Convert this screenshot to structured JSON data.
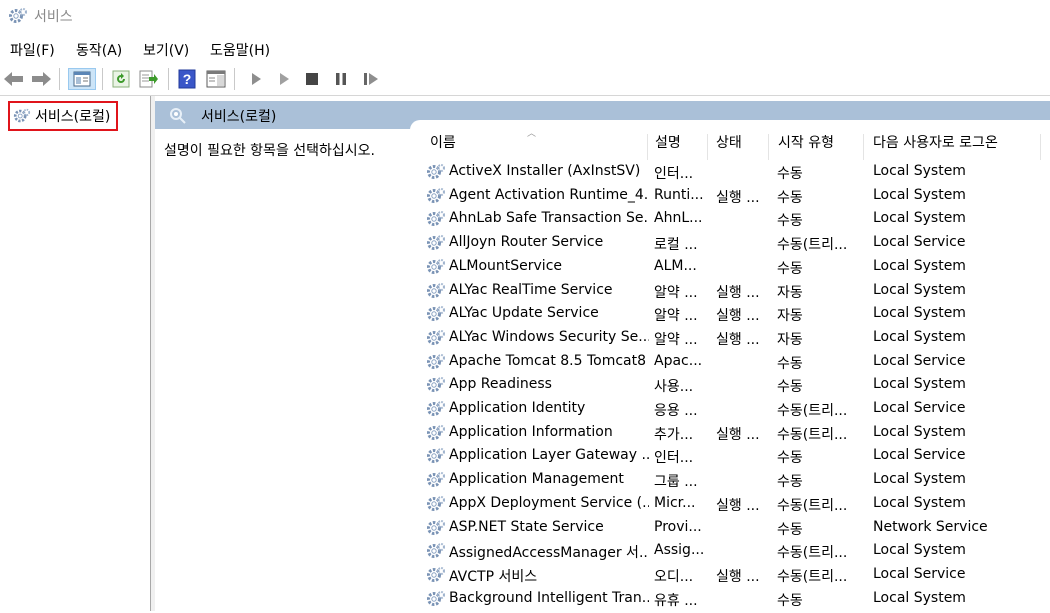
{
  "window": {
    "title": "서비스",
    "icon": "services-gear-icon"
  },
  "menu": [
    "파일(F)",
    "동작(A)",
    "보기(V)",
    "도움말(H)"
  ],
  "toolbar": {
    "buttons": [
      "back-arrow-icon",
      "forward-arrow-icon",
      "show-hide-console-tree-icon",
      "refresh-icon",
      "export-list-icon",
      "help-icon",
      "properties-pane-icon",
      "start-service-icon",
      "start-service-alt-icon",
      "stop-service-icon",
      "pause-service-icon",
      "restart-service-icon"
    ]
  },
  "tree": {
    "selected_label": "서비스(로컬)",
    "highlight_color": "#e0141b"
  },
  "right_pane": {
    "header_title": "서비스(로컬)",
    "header_color": "#aac0d8",
    "description_hint": "설명이 필요한 항목을 선택하십시오."
  },
  "columns": {
    "name": "이름",
    "description": "설명",
    "status": "상태",
    "startup": "시작 유형",
    "logon": "다음 사용자로 로그온"
  },
  "services": [
    {
      "name": "ActiveX Installer (AxInstSV)",
      "desc": "인터...",
      "status": "",
      "startup": "수동",
      "logon": "Local System"
    },
    {
      "name": "Agent Activation Runtime_4...",
      "desc": "Runti...",
      "status": "실행 ...",
      "startup": "수동",
      "logon": "Local System"
    },
    {
      "name": "AhnLab Safe Transaction Se...",
      "desc": "AhnL...",
      "status": "",
      "startup": "수동",
      "logon": "Local System"
    },
    {
      "name": "AllJoyn Router Service",
      "desc": "로컬 ...",
      "status": "",
      "startup": "수동(트리...",
      "logon": "Local Service"
    },
    {
      "name": "ALMountService",
      "desc": "ALM...",
      "status": "",
      "startup": "수동",
      "logon": "Local System"
    },
    {
      "name": "ALYac RealTime Service",
      "desc": "알약 ...",
      "status": "실행 ...",
      "startup": "자동",
      "logon": "Local System"
    },
    {
      "name": "ALYac Update Service",
      "desc": "알약 ...",
      "status": "실행 ...",
      "startup": "자동",
      "logon": "Local System"
    },
    {
      "name": "ALYac Windows Security Se...",
      "desc": "알약 ...",
      "status": "실행 ...",
      "startup": "자동",
      "logon": "Local System"
    },
    {
      "name": "Apache Tomcat 8.5 Tomcat8",
      "desc": "Apac...",
      "status": "",
      "startup": "수동",
      "logon": "Local Service"
    },
    {
      "name": "App Readiness",
      "desc": "사용...",
      "status": "",
      "startup": "수동",
      "logon": "Local System"
    },
    {
      "name": "Application Identity",
      "desc": "응용 ...",
      "status": "",
      "startup": "수동(트리...",
      "logon": "Local Service"
    },
    {
      "name": "Application Information",
      "desc": "추가...",
      "status": "실행 ...",
      "startup": "수동(트리...",
      "logon": "Local System"
    },
    {
      "name": "Application Layer Gateway ...",
      "desc": "인터...",
      "status": "",
      "startup": "수동",
      "logon": "Local Service"
    },
    {
      "name": "Application Management",
      "desc": "그룹 ...",
      "status": "",
      "startup": "수동",
      "logon": "Local System"
    },
    {
      "name": "AppX Deployment Service (...",
      "desc": "Micr...",
      "status": "실행 ...",
      "startup": "수동(트리...",
      "logon": "Local System"
    },
    {
      "name": "ASP.NET State Service",
      "desc": "Provi...",
      "status": "",
      "startup": "수동",
      "logon": "Network Service"
    },
    {
      "name": "AssignedAccessManager 서...",
      "desc": "Assig...",
      "status": "",
      "startup": "수동(트리...",
      "logon": "Local System"
    },
    {
      "name": "AVCTP 서비스",
      "desc": "오디...",
      "status": "실행 ...",
      "startup": "수동(트리...",
      "logon": "Local Service"
    },
    {
      "name": "Background Intelligent Tran...",
      "desc": "유휴 ...",
      "status": "",
      "startup": "수동",
      "logon": "Local System"
    }
  ]
}
